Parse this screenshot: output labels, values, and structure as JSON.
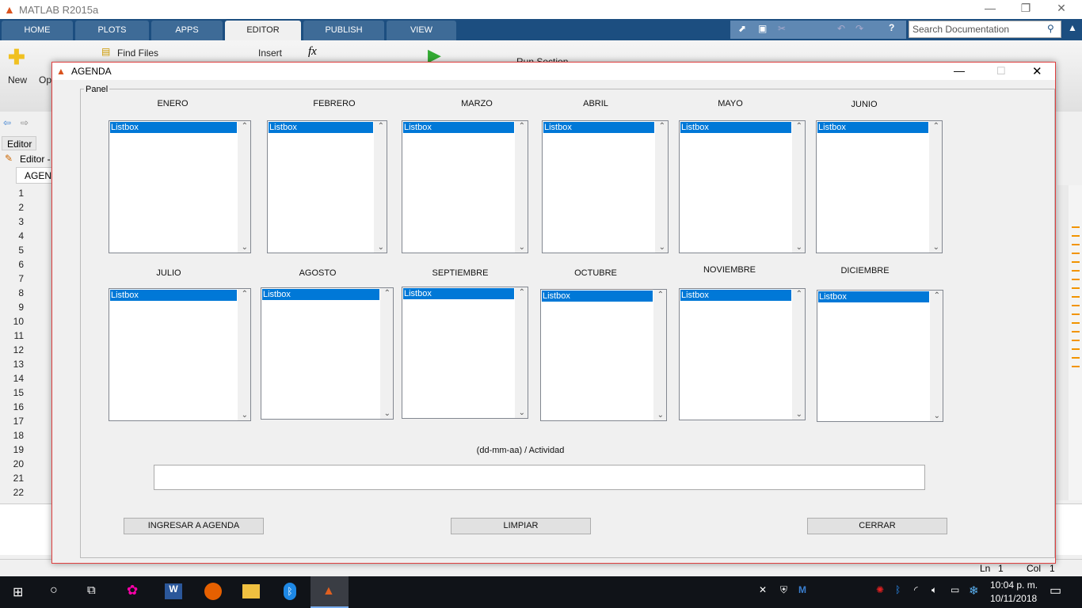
{
  "app": {
    "title": "MATLAB R2015a"
  },
  "tabs": [
    {
      "label": "HOME"
    },
    {
      "label": "PLOTS"
    },
    {
      "label": "APPS"
    },
    {
      "label": "EDITOR",
      "active": true
    },
    {
      "label": "PUBLISH"
    },
    {
      "label": "VIEW"
    }
  ],
  "search": {
    "placeholder": "Search Documentation"
  },
  "ribbon": {
    "new": "New",
    "open": "Op",
    "find_files": "Find Files",
    "insert": "Insert",
    "run_section": "Run Section"
  },
  "editor": {
    "panel_tab": "Editor",
    "title": "Editor -",
    "file_tab": "AGENDA",
    "line_numbers": [
      "1",
      "2",
      "3",
      "4",
      "5",
      "6",
      "7",
      "8",
      "9",
      "10",
      "11",
      "12",
      "13",
      "14",
      "15",
      "16",
      "17",
      "18",
      "19",
      "20",
      "21",
      "22"
    ],
    "status_ln_label": "Ln",
    "status_ln": "1",
    "status_col_label": "Col",
    "status_col": "1"
  },
  "dialog": {
    "title": "AGENDA",
    "panel_label": "Panel",
    "months": [
      {
        "label": "ENERO",
        "item": "Listbox"
      },
      {
        "label": "FEBRERO",
        "item": "Listbox"
      },
      {
        "label": "MARZO",
        "item": "Listbox"
      },
      {
        "label": "ABRIL",
        "item": "Listbox"
      },
      {
        "label": "MAYO",
        "item": "Listbox"
      },
      {
        "label": "JUNIO",
        "item": "Listbox"
      },
      {
        "label": "JULIO",
        "item": "Listbox"
      },
      {
        "label": "AGOSTO",
        "item": "Listbox"
      },
      {
        "label": "SEPTIEMBRE",
        "item": "Listbox"
      },
      {
        "label": "OCTUBRE",
        "item": "Listbox"
      },
      {
        "label": "NOVIEMBRE",
        "item": "Listbox"
      },
      {
        "label": "DICIEMBRE",
        "item": "Listbox"
      }
    ],
    "format_label": "(dd-mm-aa)  /   Actividad",
    "input_value": "",
    "buttons": {
      "add": "INGRESAR A AGENDA",
      "clear": "LIMPIAR",
      "close": "CERRAR"
    }
  },
  "taskbar": {
    "time": "10:04 p. m.",
    "date": "10/11/2018"
  },
  "colors": {
    "selection": "#0078d7",
    "tabbar": "#1c4e80",
    "dialog_border": "#e04040"
  }
}
